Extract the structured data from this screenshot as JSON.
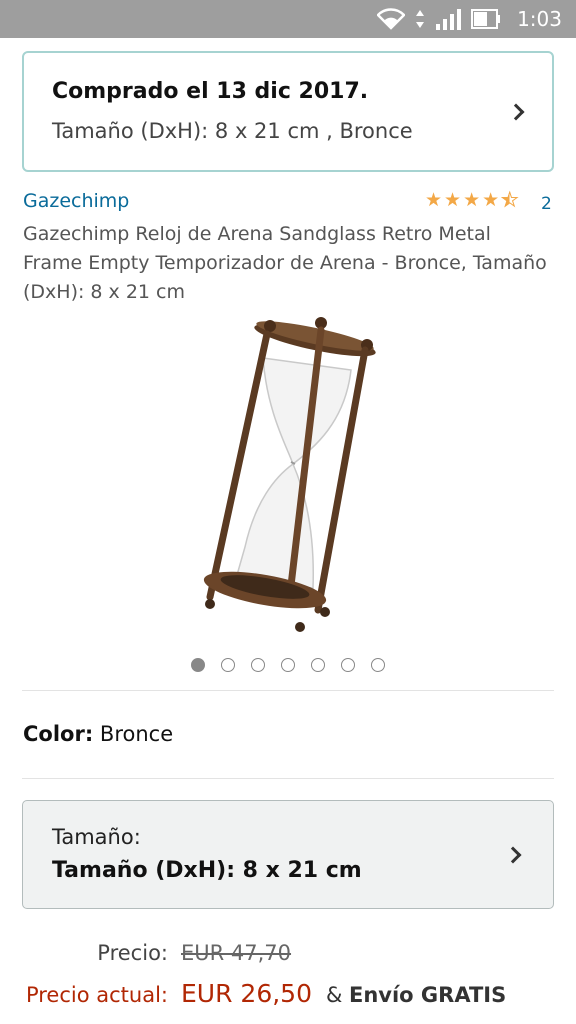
{
  "status_bar": {
    "time": "1:03",
    "icons": [
      "wifi-icon",
      "data-transfer-icon",
      "cell-signal-icon",
      "battery-icon"
    ],
    "background": "#9e9e9e"
  },
  "purchase_notice": {
    "date_text": "Comprado el 13 dic 2017.",
    "size_text": "Tamaño (DxH): 8 x 21 cm , Bronce",
    "border_color": "#a6d3d1"
  },
  "product": {
    "brand": "Gazechimp",
    "rating": 4.5,
    "review_count": "2",
    "title": "Gazechimp Reloj de Arena Sandglass Retro Metal Frame Empty Temporizador de Arena - Bronce, Tamaño (DxH): 8 x 21 cm",
    "image": "hourglass-image",
    "image_count": 7,
    "active_image_index": 0
  },
  "color": {
    "label": "Color:",
    "value": "Bronce"
  },
  "size_selector": {
    "label": "Tamaño:",
    "value": "Tamaño (DxH): 8 x 21 cm"
  },
  "pricing": {
    "list_price_label": "Precio:",
    "list_price": "EUR 47,70",
    "current_price_label": "Precio actual:",
    "current_price": "EUR 26,50",
    "amp": "&",
    "shipping": "Envío GRATIS",
    "price_color": "#b12704"
  },
  "colors": {
    "link": "#0a6b9a",
    "star": "#f3a847"
  }
}
